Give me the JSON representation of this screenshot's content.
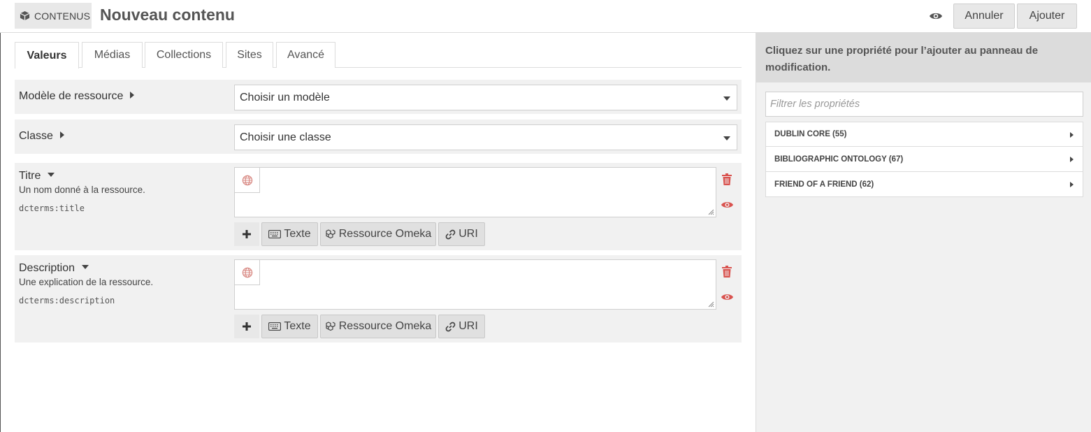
{
  "header": {
    "section_label": "CONTENUS",
    "title": "Nouveau contenu",
    "cancel_label": "Annuler",
    "add_label": "Ajouter"
  },
  "tabs": [
    {
      "label": "Valeurs",
      "active": true
    },
    {
      "label": "Médias",
      "active": false
    },
    {
      "label": "Collections",
      "active": false
    },
    {
      "label": "Sites",
      "active": false
    },
    {
      "label": "Avancé",
      "active": false
    }
  ],
  "form": {
    "template_label": "Modèle de ressource",
    "template_value": "Choisir un modèle",
    "class_label": "Classe",
    "class_value": "Choisir une classe",
    "properties": [
      {
        "label": "Titre",
        "description": "Un nom donné à la ressource.",
        "term": "dcterms:title",
        "value": ""
      },
      {
        "label": "Description",
        "description": "Une explication de la ressource.",
        "term": "dcterms:description",
        "value": ""
      }
    ],
    "value_types": {
      "text": "Texte",
      "resource": "Ressource Omeka",
      "uri": "URI"
    }
  },
  "sidebar": {
    "instruction": "Cliquez sur une propriété pour l’ajouter au panneau de modification.",
    "filter_placeholder": "Filtrer les propriétés",
    "vocabularies": [
      {
        "label": "DUBLIN CORE (55)"
      },
      {
        "label": "BIBLIOGRAPHIC ONTOLOGY (67)"
      },
      {
        "label": "FRIEND OF A FRIEND (62)"
      }
    ]
  },
  "colors": {
    "danger": "#d9534f",
    "panel": "#f1f1f1",
    "button": "#e8e8e8"
  },
  "icons": [
    "cube-icon",
    "eye-icon",
    "globe-icon",
    "trash-icon",
    "plus-icon",
    "keyboard-icon",
    "cubes-icon",
    "link-icon",
    "resize-grip-icon"
  ]
}
